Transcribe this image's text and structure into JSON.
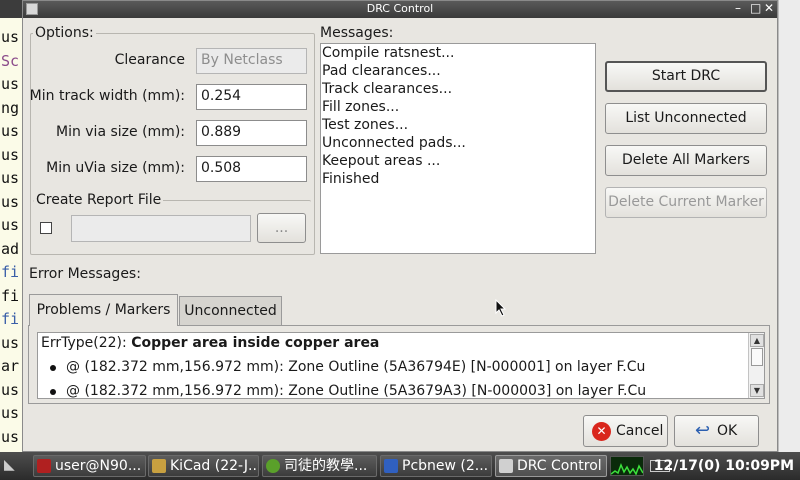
{
  "background": {
    "left_lines": [
      "us",
      "Sc",
      "us",
      "ng",
      "us",
      "us",
      "us",
      "us",
      "us",
      "ad",
      "fi",
      "fi",
      "fi",
      "us",
      "ar",
      "us",
      "us",
      "us"
    ]
  },
  "dialog": {
    "title": "DRC Control",
    "options": {
      "legend": "Options:",
      "clearance_label": "Clearance",
      "clearance_value": "By Netclass",
      "min_track_label": "Min track width (mm):",
      "min_track_value": "0.254",
      "min_via_label": "Min via size (mm):",
      "min_via_value": "0.889",
      "min_uvia_label": "Min uVia size (mm):",
      "min_uvia_value": "0.508"
    },
    "report": {
      "legend": "Create Report File",
      "path_value": "",
      "browse_label": "..."
    },
    "messages": {
      "label": "Messages:",
      "lines": [
        "Compile ratsnest...",
        "Pad clearances...",
        "Track clearances...",
        "Fill zones...",
        "Test zones...",
        "Unconnected pads...",
        "Keepout areas ...",
        "Finished"
      ]
    },
    "buttons": {
      "start_drc": "Start DRC",
      "list_unconnected": "List Unconnected",
      "delete_all": "Delete All Markers",
      "delete_current": "Delete Current Marker"
    },
    "error_messages_label": "Error Messages:",
    "tabs": [
      "Problems / Markers",
      "Unconnected"
    ],
    "errors": {
      "head_prefix": "ErrType(22): ",
      "head_bold": "Copper area inside copper area",
      "items": [
        "@ (182.372 mm,156.972 mm): Zone Outline (5A36794E) [N-000001] on layer F.Cu",
        "@ (182.372 mm,156.972 mm): Zone Outline (5A3679A3) [N-000003] on layer F.Cu"
      ]
    },
    "footer": {
      "cancel": "Cancel",
      "ok": "OK"
    }
  },
  "taskbar": {
    "tasks": [
      "user@N90...",
      "KiCad (22-J...",
      "司徒的教學...",
      "Pcbnew (2...",
      "DRC Control"
    ],
    "clock": "12/17(0) 10:09PM",
    "colors": {
      "terminal": "#b02020",
      "kicad": "#c8a040",
      "browser": "#5aa02a",
      "pcbnew": "#3060c0",
      "drc": "#d0d0d0"
    }
  }
}
